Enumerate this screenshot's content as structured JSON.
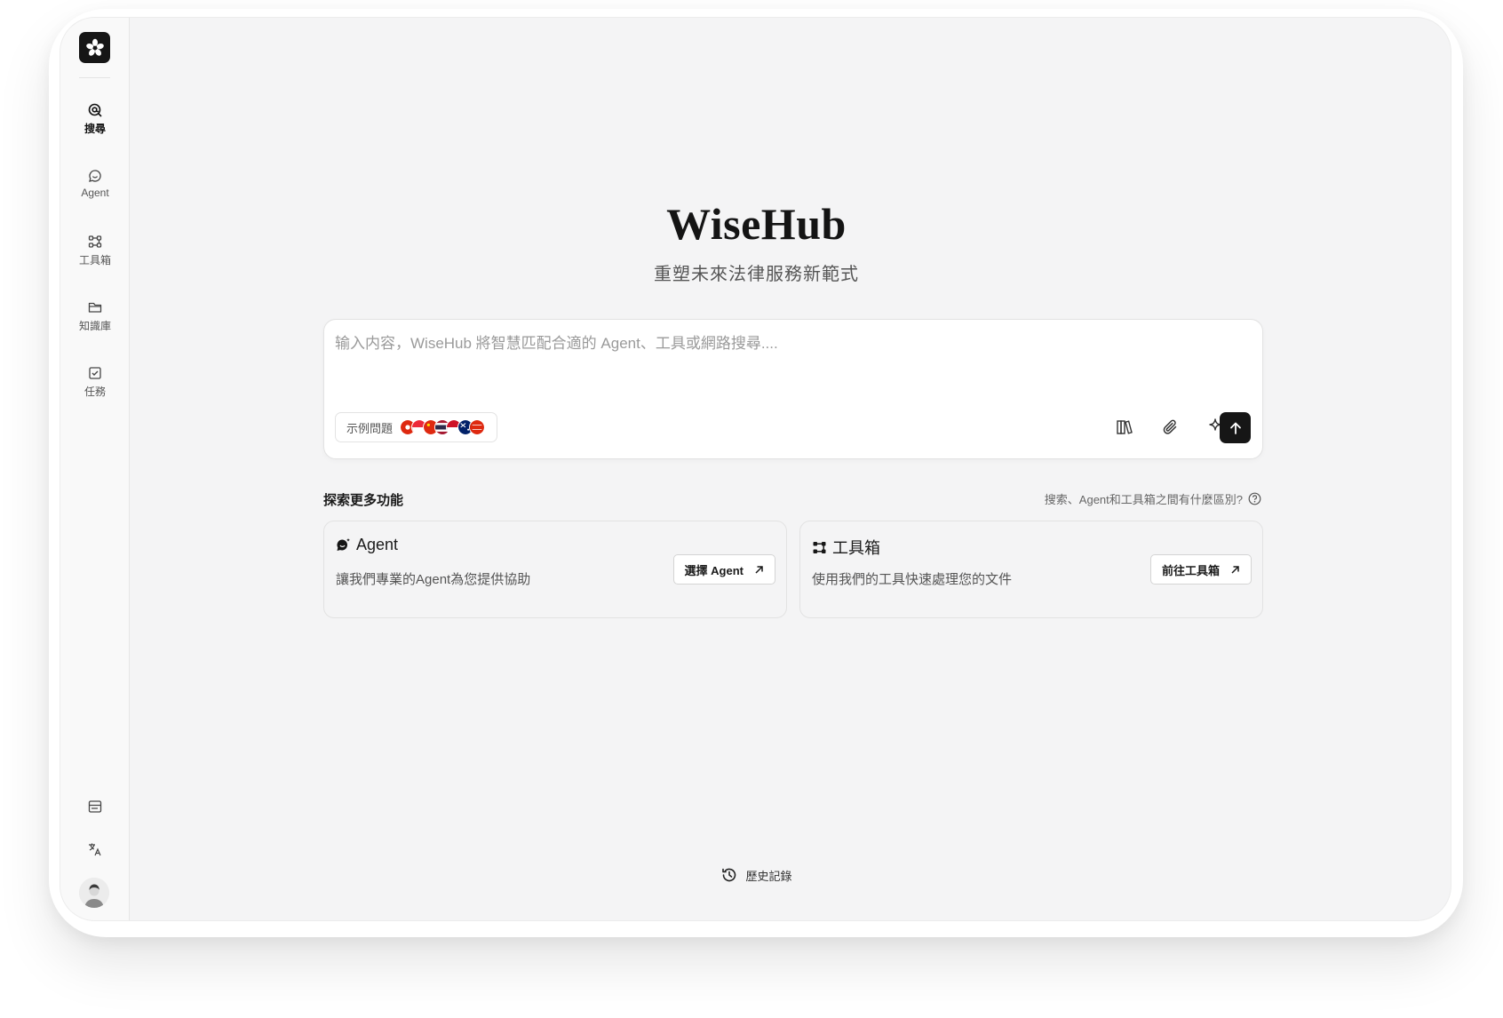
{
  "app": {
    "brand": "WiseHub",
    "tagline": "重塑未來法律服務新範式"
  },
  "sidebar": {
    "logo_icon": "flower-logo-icon",
    "items": [
      {
        "label": "搜尋",
        "icon": "search-at-icon",
        "active": true
      },
      {
        "label": "Agent",
        "icon": "chat-bubble-icon",
        "active": false
      },
      {
        "label": "工具箱",
        "icon": "workflow-icon",
        "active": false
      },
      {
        "label": "知識庫",
        "icon": "folder-icon",
        "active": false
      },
      {
        "label": "任務",
        "icon": "checkbox-icon",
        "active": false
      }
    ],
    "bottom_icons": [
      "panel-icon",
      "translate-icon"
    ],
    "avatar": "user-avatar"
  },
  "search": {
    "placeholder": "输入内容，WiseHub 將智慧匹配合適的 Agent、工具或網路搜尋....",
    "value": "",
    "examples_label": "示例問題",
    "example_flags": [
      "hong-kong",
      "singapore",
      "china",
      "thailand",
      "indonesia",
      "australia",
      "mainland"
    ],
    "tools": [
      "library-icon",
      "paperclip-icon",
      "sparkle-icon"
    ],
    "send_icon": "arrow-up-icon"
  },
  "explore": {
    "title": "探索更多功能",
    "diff_link": "搜索、Agent和工具箱之間有什麼區別?",
    "cards": [
      {
        "title": "Agent",
        "icon": "chat-sparkle-icon",
        "desc": "讓我們專業的Agent為您提供協助",
        "button": "選擇 Agent"
      },
      {
        "title": "工具箱",
        "icon": "workflow-icon",
        "desc": "使用我們的工具快速處理您的文件",
        "button": "前往工具箱"
      }
    ]
  },
  "footer": {
    "history_label": "歷史記錄"
  },
  "colors": {
    "background": "#f4f4f5",
    "sidebar": "#f9f9f9",
    "accent": "#161616"
  }
}
